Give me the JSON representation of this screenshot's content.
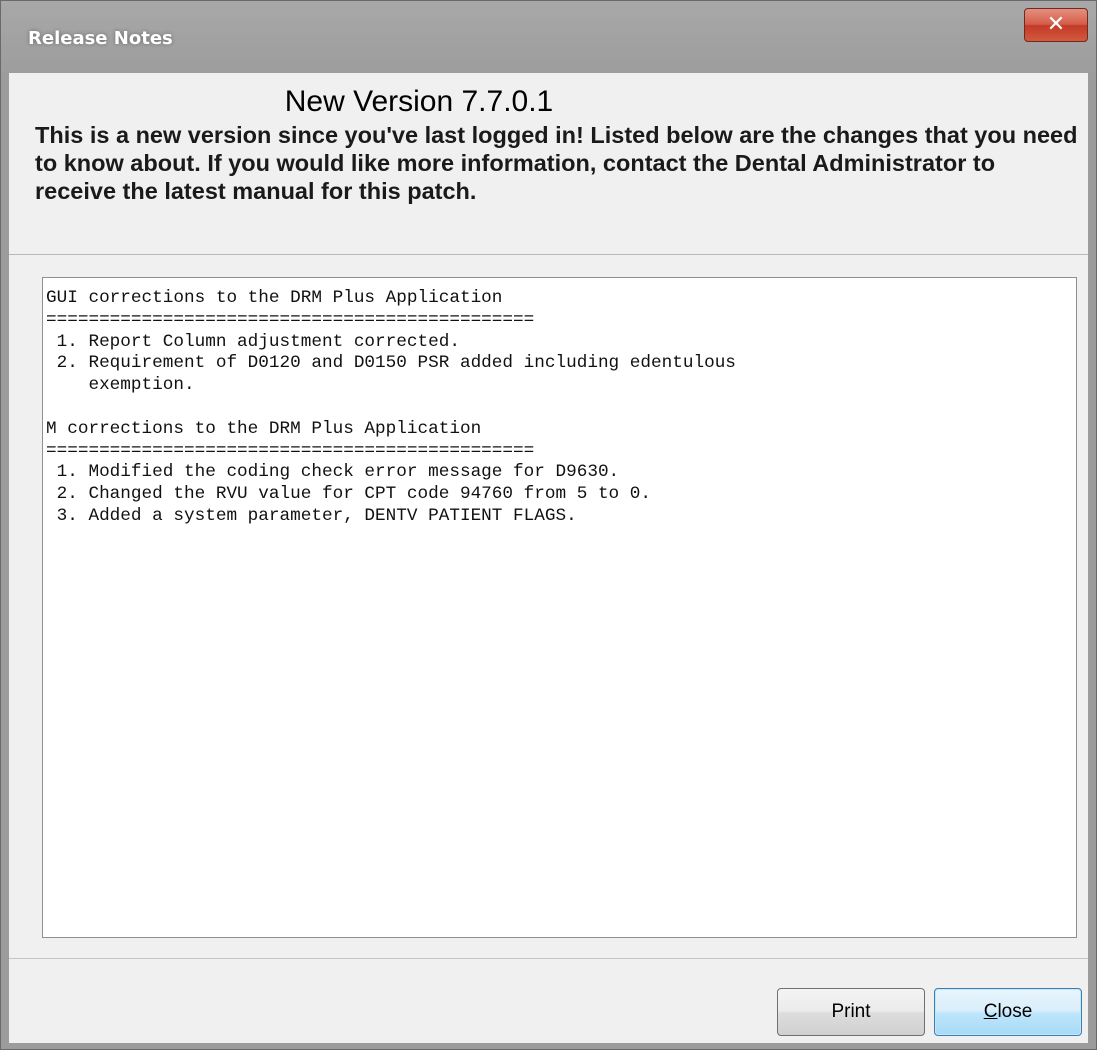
{
  "window": {
    "title": "Release Notes",
    "close_glyph": "✕",
    "close_icon": "close-icon"
  },
  "header": {
    "version_title": "New Version 7.7.0.1",
    "intro_text": "This is a new version since you've last logged in!  Listed below are the changes that you need to know about.  If you would like more information, contact the Dental Administrator to receive the latest manual for this patch."
  },
  "notes": {
    "text": "GUI corrections to the DRM Plus Application\n==============================================\n 1. Report Column adjustment corrected.\n 2. Requirement of D0120 and D0150 PSR added including edentulous\n    exemption.\n\nM corrections to the DRM Plus Application\n==============================================\n 1. Modified the coding check error message for D9630.\n 2. Changed the RVU value for CPT code 94760 from 5 to 0.\n 3. Added a system parameter, DENTV PATIENT FLAGS."
  },
  "buttons": {
    "print_label": "Print",
    "close_mnemonic": "C",
    "close_rest": "lose"
  },
  "colors": {
    "titlebar": "#9c9c9c",
    "panel": "#f0f0f0",
    "close_x": "#c33a27",
    "default_button": "#bee6fd"
  }
}
